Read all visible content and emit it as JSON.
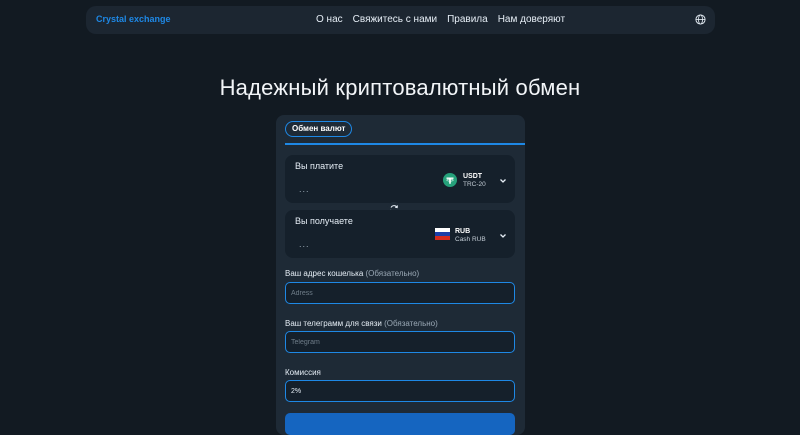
{
  "navbar": {
    "brand": "Crystal exchange",
    "links": [
      "О нас",
      "Свяжитесь с нами",
      "Правила",
      "Нам доверяют"
    ],
    "lang_icon": "globe-icon"
  },
  "hero": {
    "title": "Надежный криптовалютный обмен"
  },
  "exchange": {
    "tab_label": "Обмен валют",
    "pay": {
      "label": "Вы платите",
      "amount": "...",
      "currency_code": "USDT",
      "currency_network": "TRC-20",
      "icon": "tether-icon",
      "icon_color": "#26a17b"
    },
    "swap_icon": "refresh-icon",
    "receive": {
      "label": "Вы получаете",
      "amount": "...",
      "currency_code": "RUB",
      "currency_network": "Cash RUB",
      "icon": "russia-flag-icon"
    },
    "wallet": {
      "label": "Ваш адрес кошелька",
      "hint": "(Обязательно)",
      "placeholder": "Adress"
    },
    "telegram": {
      "label": "Ваш телеграмм для связи",
      "hint": "(Обязательно)",
      "placeholder": "Telegram"
    },
    "commission": {
      "label": "Комиссия",
      "value": "2%"
    }
  },
  "colors": {
    "accent": "#1e88e5",
    "background": "#121a22",
    "card": "#1e2a36",
    "box": "#15202b"
  }
}
